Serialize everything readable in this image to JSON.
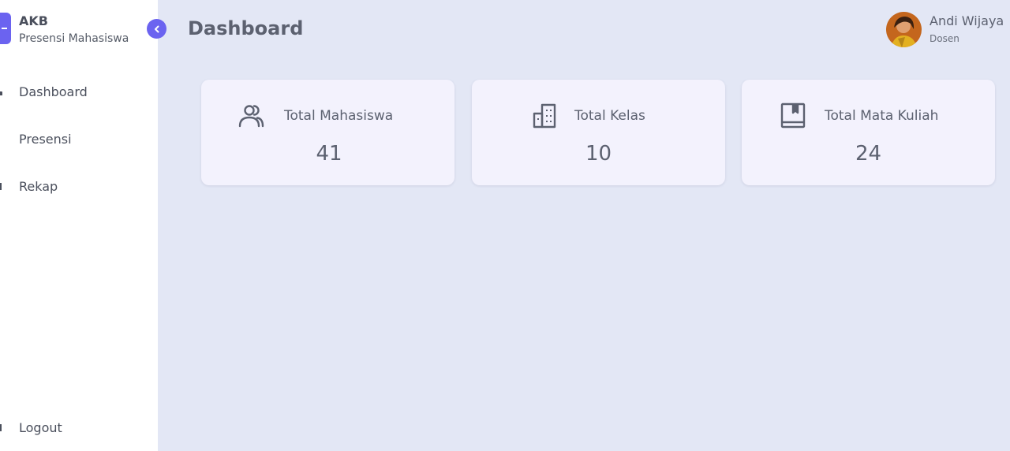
{
  "brand": {
    "title": "AKB",
    "subtitle": "Presensi Mahasiswa",
    "accent": "#6b63f0"
  },
  "sidebar": {
    "items": [
      {
        "label": "Dashboard",
        "icon": "dashboard-icon"
      },
      {
        "label": "Presensi",
        "icon": "presensi-icon"
      },
      {
        "label": "Rekap",
        "icon": "rekap-icon"
      }
    ],
    "logout_label": "Logout"
  },
  "header": {
    "title": "Dashboard"
  },
  "user": {
    "name": "Andi Wijaya",
    "role": "Dosen"
  },
  "cards": [
    {
      "label": "Total Mahasiswa",
      "value": "41",
      "icon": "users-icon"
    },
    {
      "label": "Total Kelas",
      "value": "10",
      "icon": "building-icon"
    },
    {
      "label": "Total Mata Kuliah",
      "value": "24",
      "icon": "book-icon"
    }
  ]
}
